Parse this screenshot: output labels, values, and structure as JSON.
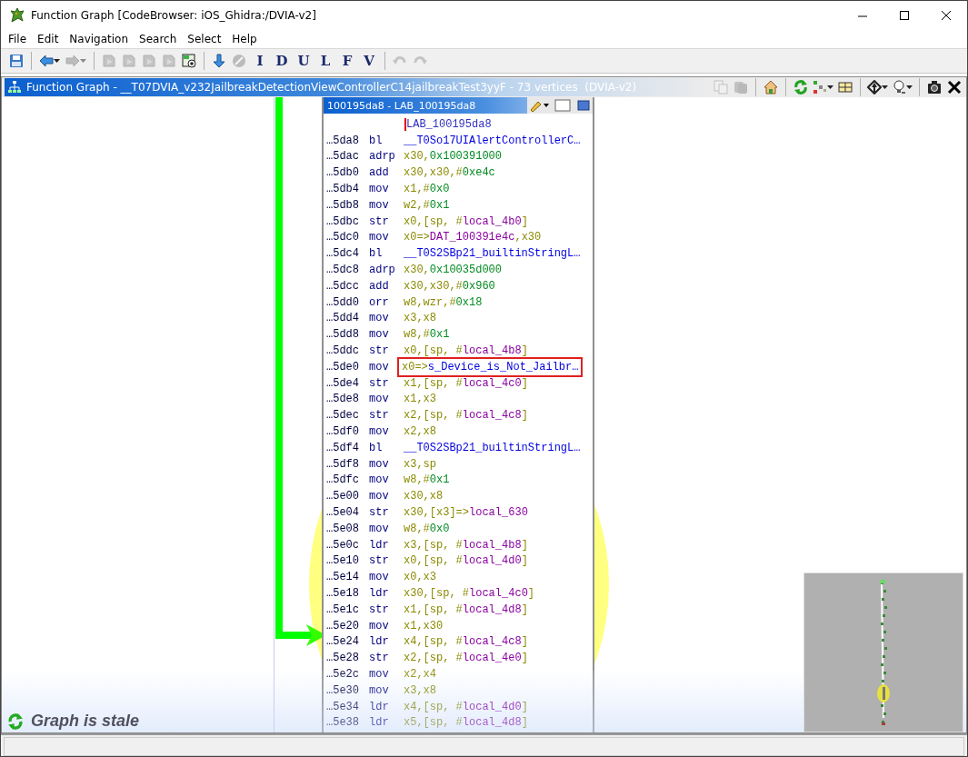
{
  "window": {
    "title": "Function Graph [CodeBrowser: iOS_Ghidra:/DVIA-v2]"
  },
  "menu": [
    "File",
    "Edit",
    "Navigation",
    "Search",
    "Select",
    "Help"
  ],
  "toolbar": [
    {
      "kind": "save",
      "disabled": false
    },
    {
      "kind": "separator"
    },
    {
      "kind": "back",
      "disabled": false,
      "dropdown": true
    },
    {
      "kind": "forward",
      "disabled": true,
      "dropdown": true
    },
    {
      "kind": "separator"
    },
    {
      "kind": "doc",
      "disabled": true
    },
    {
      "kind": "doc",
      "disabled": true
    },
    {
      "kind": "doc",
      "disabled": true
    },
    {
      "kind": "doc",
      "disabled": true
    },
    {
      "kind": "snapshot",
      "disabled": false
    },
    {
      "kind": "separator"
    },
    {
      "kind": "arrow-down",
      "disabled": false
    },
    {
      "kind": "stop",
      "disabled": true
    },
    {
      "kind": "letter",
      "label": "I",
      "disabled": false
    },
    {
      "kind": "letter",
      "label": "D",
      "disabled": false
    },
    {
      "kind": "letter",
      "label": "U",
      "disabled": false
    },
    {
      "kind": "letter",
      "label": "L",
      "disabled": false
    },
    {
      "kind": "letter",
      "label": "F",
      "disabled": false
    },
    {
      "kind": "letter",
      "label": "V",
      "disabled": false
    },
    {
      "kind": "separator"
    },
    {
      "kind": "undo",
      "disabled": true
    },
    {
      "kind": "redo",
      "disabled": true
    }
  ],
  "graph_panel": {
    "title": "Function Graph - __T07DVIA_v232JailbreakDetectionViewControllerC14jailbreakTest3yyF - 73 vertices  (DVIA-v2)",
    "tools": [
      {
        "kind": "copy",
        "disabled": true
      },
      {
        "kind": "paste",
        "disabled": true
      },
      {
        "kind": "separator"
      },
      {
        "kind": "home",
        "disabled": false
      },
      {
        "kind": "separator"
      },
      {
        "kind": "refresh",
        "disabled": false
      },
      {
        "kind": "layout",
        "disabled": false,
        "dropdown": true
      },
      {
        "kind": "fields",
        "disabled": false
      },
      {
        "kind": "separator"
      },
      {
        "kind": "navigate",
        "disabled": false,
        "dropdown": true
      },
      {
        "kind": "bulb",
        "disabled": false,
        "dropdown": true
      },
      {
        "kind": "separator"
      },
      {
        "kind": "camera",
        "disabled": false
      },
      {
        "kind": "close",
        "disabled": false
      }
    ]
  },
  "node": {
    "title": "100195da8 - LAB_100195da8",
    "label": "LAB_100195da8",
    "rows": [
      {
        "address": "…5da8",
        "mnemonic": "bl",
        "operands": [
          {
            "text": "__T0So17UIAlertControllerC…",
            "kind": "sym"
          }
        ],
        "highlighted": false
      },
      {
        "address": "…5dac",
        "mnemonic": "adrp",
        "operands": [
          {
            "text": "x30,",
            "kind": "reg"
          },
          {
            "text": "0x100391000",
            "kind": "num"
          }
        ],
        "highlighted": false
      },
      {
        "address": "…5db0",
        "mnemonic": "add",
        "operands": [
          {
            "text": "x30,x30,#",
            "kind": "reg"
          },
          {
            "text": "0xe4c",
            "kind": "num"
          }
        ],
        "highlighted": false
      },
      {
        "address": "…5db4",
        "mnemonic": "mov",
        "operands": [
          {
            "text": "x1,#",
            "kind": "reg"
          },
          {
            "text": "0x0",
            "kind": "num"
          }
        ],
        "highlighted": false
      },
      {
        "address": "…5db8",
        "mnemonic": "mov",
        "operands": [
          {
            "text": "w2,#",
            "kind": "reg"
          },
          {
            "text": "0x1",
            "kind": "num"
          }
        ],
        "highlighted": false
      },
      {
        "address": "…5dbc",
        "mnemonic": "str",
        "operands": [
          {
            "text": "x0,[sp, #",
            "kind": "reg"
          },
          {
            "text": "local_4b0",
            "kind": "var"
          },
          {
            "text": "]",
            "kind": "reg"
          }
        ],
        "highlighted": false
      },
      {
        "address": "…5dc0",
        "mnemonic": "mov",
        "operands": [
          {
            "text": "x0=>",
            "kind": "reg"
          },
          {
            "text": "DAT_100391e4c",
            "kind": "var"
          },
          {
            "text": ",x30",
            "kind": "reg"
          }
        ],
        "highlighted": false
      },
      {
        "address": "…5dc4",
        "mnemonic": "bl",
        "operands": [
          {
            "text": "__T0S2SBp21_builtinStringL…",
            "kind": "sym"
          }
        ],
        "highlighted": false
      },
      {
        "address": "…5dc8",
        "mnemonic": "adrp",
        "operands": [
          {
            "text": "x30,",
            "kind": "reg"
          },
          {
            "text": "0x10035d000",
            "kind": "num"
          }
        ],
        "highlighted": false
      },
      {
        "address": "…5dcc",
        "mnemonic": "add",
        "operands": [
          {
            "text": "x30,x30,#",
            "kind": "reg"
          },
          {
            "text": "0x960",
            "kind": "num"
          }
        ],
        "highlighted": false
      },
      {
        "address": "…5dd0",
        "mnemonic": "orr",
        "operands": [
          {
            "text": "w8,wzr,#",
            "kind": "reg"
          },
          {
            "text": "0x18",
            "kind": "num"
          }
        ],
        "highlighted": false
      },
      {
        "address": "…5dd4",
        "mnemonic": "mov",
        "operands": [
          {
            "text": "x3,x8",
            "kind": "reg"
          }
        ],
        "highlighted": false
      },
      {
        "address": "…5dd8",
        "mnemonic": "mov",
        "operands": [
          {
            "text": "w8,#",
            "kind": "reg"
          },
          {
            "text": "0x1",
            "kind": "num"
          }
        ],
        "highlighted": false
      },
      {
        "address": "…5ddc",
        "mnemonic": "str",
        "operands": [
          {
            "text": "x0,[sp, #",
            "kind": "reg"
          },
          {
            "text": "local_4b8",
            "kind": "var"
          },
          {
            "text": "]",
            "kind": "reg"
          }
        ],
        "highlighted": false
      },
      {
        "address": "…5de0",
        "mnemonic": "mov",
        "operands": [
          {
            "text": "x0=>",
            "kind": "reg"
          },
          {
            "text": "s_Device_is_Not_Jailbr…",
            "kind": "sym"
          }
        ],
        "highlighted": true
      },
      {
        "address": "…5de4",
        "mnemonic": "str",
        "operands": [
          {
            "text": "x1,[sp, #",
            "kind": "reg"
          },
          {
            "text": "local_4c0",
            "kind": "var"
          },
          {
            "text": "]",
            "kind": "reg"
          }
        ],
        "highlighted": false
      },
      {
        "address": "…5de8",
        "mnemonic": "mov",
        "operands": [
          {
            "text": "x1,x3",
            "kind": "reg"
          }
        ],
        "highlighted": false
      },
      {
        "address": "…5dec",
        "mnemonic": "str",
        "operands": [
          {
            "text": "x2,[sp, #",
            "kind": "reg"
          },
          {
            "text": "local_4c8",
            "kind": "var"
          },
          {
            "text": "]",
            "kind": "reg"
          }
        ],
        "highlighted": false
      },
      {
        "address": "…5df0",
        "mnemonic": "mov",
        "operands": [
          {
            "text": "x2,x8",
            "kind": "reg"
          }
        ],
        "highlighted": false
      },
      {
        "address": "…5df4",
        "mnemonic": "bl",
        "operands": [
          {
            "text": "__T0S2SBp21_builtinStringL…",
            "kind": "sym"
          }
        ],
        "highlighted": false
      },
      {
        "address": "…5df8",
        "mnemonic": "mov",
        "operands": [
          {
            "text": "x3,sp",
            "kind": "reg"
          }
        ],
        "highlighted": false
      },
      {
        "address": "…5dfc",
        "mnemonic": "mov",
        "operands": [
          {
            "text": "w8,#",
            "kind": "reg"
          },
          {
            "text": "0x1",
            "kind": "num"
          }
        ],
        "highlighted": false
      },
      {
        "address": "…5e00",
        "mnemonic": "mov",
        "operands": [
          {
            "text": "x30,x8",
            "kind": "reg"
          }
        ],
        "highlighted": false
      },
      {
        "address": "…5e04",
        "mnemonic": "str",
        "operands": [
          {
            "text": "x30,[x3]=>",
            "kind": "reg"
          },
          {
            "text": "local_630",
            "kind": "var"
          }
        ],
        "highlighted": false
      },
      {
        "address": "…5e08",
        "mnemonic": "mov",
        "operands": [
          {
            "text": "w8,#",
            "kind": "reg"
          },
          {
            "text": "0x0",
            "kind": "num"
          }
        ],
        "highlighted": false
      },
      {
        "address": "…5e0c",
        "mnemonic": "ldr",
        "operands": [
          {
            "text": "x3,[sp, #",
            "kind": "reg"
          },
          {
            "text": "local_4b8",
            "kind": "var"
          },
          {
            "text": "]",
            "kind": "reg"
          }
        ],
        "highlighted": false
      },
      {
        "address": "…5e10",
        "mnemonic": "str",
        "operands": [
          {
            "text": "x0,[sp, #",
            "kind": "reg"
          },
          {
            "text": "local_4d0",
            "kind": "var"
          },
          {
            "text": "]",
            "kind": "reg"
          }
        ],
        "highlighted": false
      },
      {
        "address": "…5e14",
        "mnemonic": "mov",
        "operands": [
          {
            "text": "x0,x3",
            "kind": "reg"
          }
        ],
        "highlighted": false
      },
      {
        "address": "…5e18",
        "mnemonic": "ldr",
        "operands": [
          {
            "text": "x30,[sp, #",
            "kind": "reg"
          },
          {
            "text": "local_4c0",
            "kind": "var"
          },
          {
            "text": "]",
            "kind": "reg"
          }
        ],
        "highlighted": false
      },
      {
        "address": "…5e1c",
        "mnemonic": "str",
        "operands": [
          {
            "text": "x1,[sp, #",
            "kind": "reg"
          },
          {
            "text": "local_4d8",
            "kind": "var"
          },
          {
            "text": "]",
            "kind": "reg"
          }
        ],
        "highlighted": false
      },
      {
        "address": "…5e20",
        "mnemonic": "mov",
        "operands": [
          {
            "text": "x1,x30",
            "kind": "reg"
          }
        ],
        "highlighted": false
      },
      {
        "address": "…5e24",
        "mnemonic": "ldr",
        "operands": [
          {
            "text": "x4,[sp, #",
            "kind": "reg"
          },
          {
            "text": "local_4c8",
            "kind": "var"
          },
          {
            "text": "]",
            "kind": "reg"
          }
        ],
        "highlighted": false
      },
      {
        "address": "…5e28",
        "mnemonic": "str",
        "operands": [
          {
            "text": "x2,[sp, #",
            "kind": "reg"
          },
          {
            "text": "local_4e0",
            "kind": "var"
          },
          {
            "text": "]",
            "kind": "reg"
          }
        ],
        "highlighted": false
      },
      {
        "address": "…5e2c",
        "mnemonic": "mov",
        "operands": [
          {
            "text": "x2,x4",
            "kind": "reg"
          }
        ],
        "highlighted": false
      },
      {
        "address": "…5e30",
        "mnemonic": "mov",
        "operands": [
          {
            "text": "x3,x8",
            "kind": "reg"
          }
        ],
        "highlighted": false
      },
      {
        "address": "…5e34",
        "mnemonic": "ldr",
        "operands": [
          {
            "text": "x4,[sp, #",
            "kind": "reg"
          },
          {
            "text": "local_4d0",
            "kind": "var"
          },
          {
            "text": "]",
            "kind": "reg"
          }
        ],
        "highlighted": false
      },
      {
        "address": "…5e38",
        "mnemonic": "ldr",
        "operands": [
          {
            "text": "x5,[sp, #",
            "kind": "reg"
          },
          {
            "text": "local_4d8",
            "kind": "var"
          },
          {
            "text": "]",
            "kind": "reg"
          }
        ],
        "highlighted": false
      }
    ]
  },
  "stale_notice": {
    "text": "Graph is stale"
  }
}
